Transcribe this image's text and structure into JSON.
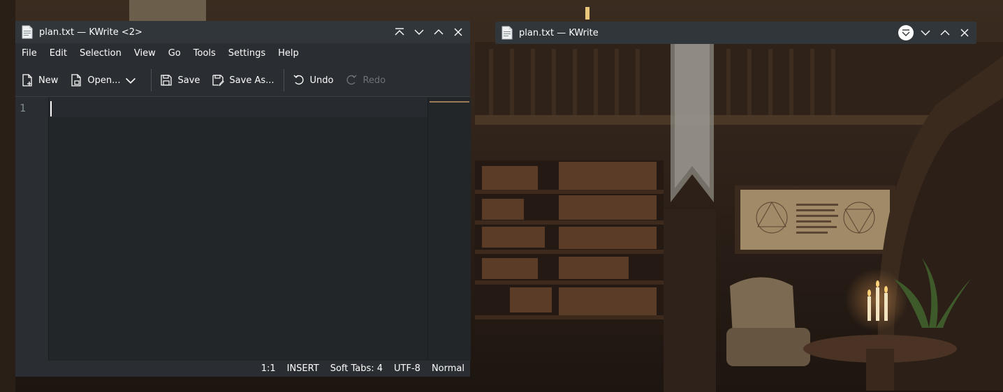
{
  "window1": {
    "title": "plan.txt — KWrite <2>",
    "icon": "text-document-icon",
    "buttons": [
      "keep-above-icon",
      "minimize-icon",
      "maximize-icon",
      "close-icon"
    ],
    "menu": [
      "File",
      "Edit",
      "Selection",
      "View",
      "Go",
      "Tools",
      "Settings",
      "Help"
    ],
    "toolbar": {
      "new": "New",
      "open": "Open...",
      "save": "Save",
      "save_as": "Save As...",
      "undo": "Undo",
      "redo": "Redo"
    },
    "editor": {
      "line_number": "1",
      "content": ""
    },
    "status": {
      "position": "1:1",
      "mode": "INSERT",
      "indent": "Soft Tabs: 4",
      "encoding": "UTF-8",
      "syntax": "Normal"
    }
  },
  "window2": {
    "title": "plan.txt — KWrite",
    "icon": "text-document-icon",
    "state": "shaded",
    "buttons": [
      "keep-above-active-icon",
      "minimize-icon",
      "maximize-icon",
      "close-icon"
    ]
  },
  "colors": {
    "titlebar": "#31363b",
    "window_bg": "#2a2e32",
    "editor_bg": "#232629",
    "text": "#fcfcfc",
    "disabled_text": "#6e7175"
  }
}
